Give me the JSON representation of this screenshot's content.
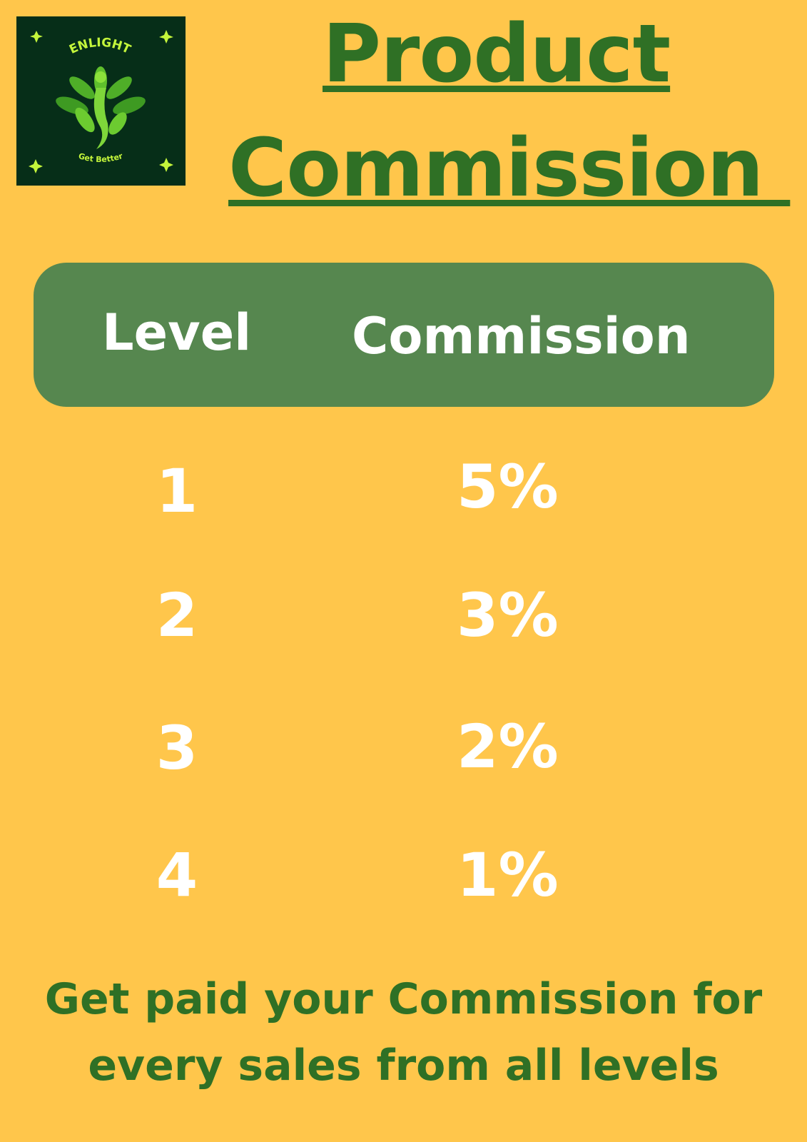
{
  "logo": {
    "brand_text": "ENLIGHT",
    "tagline": "Get Better",
    "background_color": "#062E18",
    "accent_color": "#C4F53B",
    "icon": "leaf-figure-icon"
  },
  "title": {
    "line1": "Product",
    "line2": "Commission "
  },
  "table": {
    "header": {
      "level_label": "Level",
      "commission_label": "Commission"
    },
    "rows": [
      {
        "level": "1",
        "commission": "5%"
      },
      {
        "level": "2",
        "commission": "3%"
      },
      {
        "level": "3",
        "commission": "2%"
      },
      {
        "level": "4",
        "commission": "1%"
      }
    ]
  },
  "footer": {
    "line1": "Get paid your Commission for",
    "line2": "every sales from all levels"
  },
  "colors": {
    "background": "#FFC64B",
    "title_green": "#2F7025",
    "header_bar": "#56874F",
    "cell_text": "#FFFFFF"
  }
}
